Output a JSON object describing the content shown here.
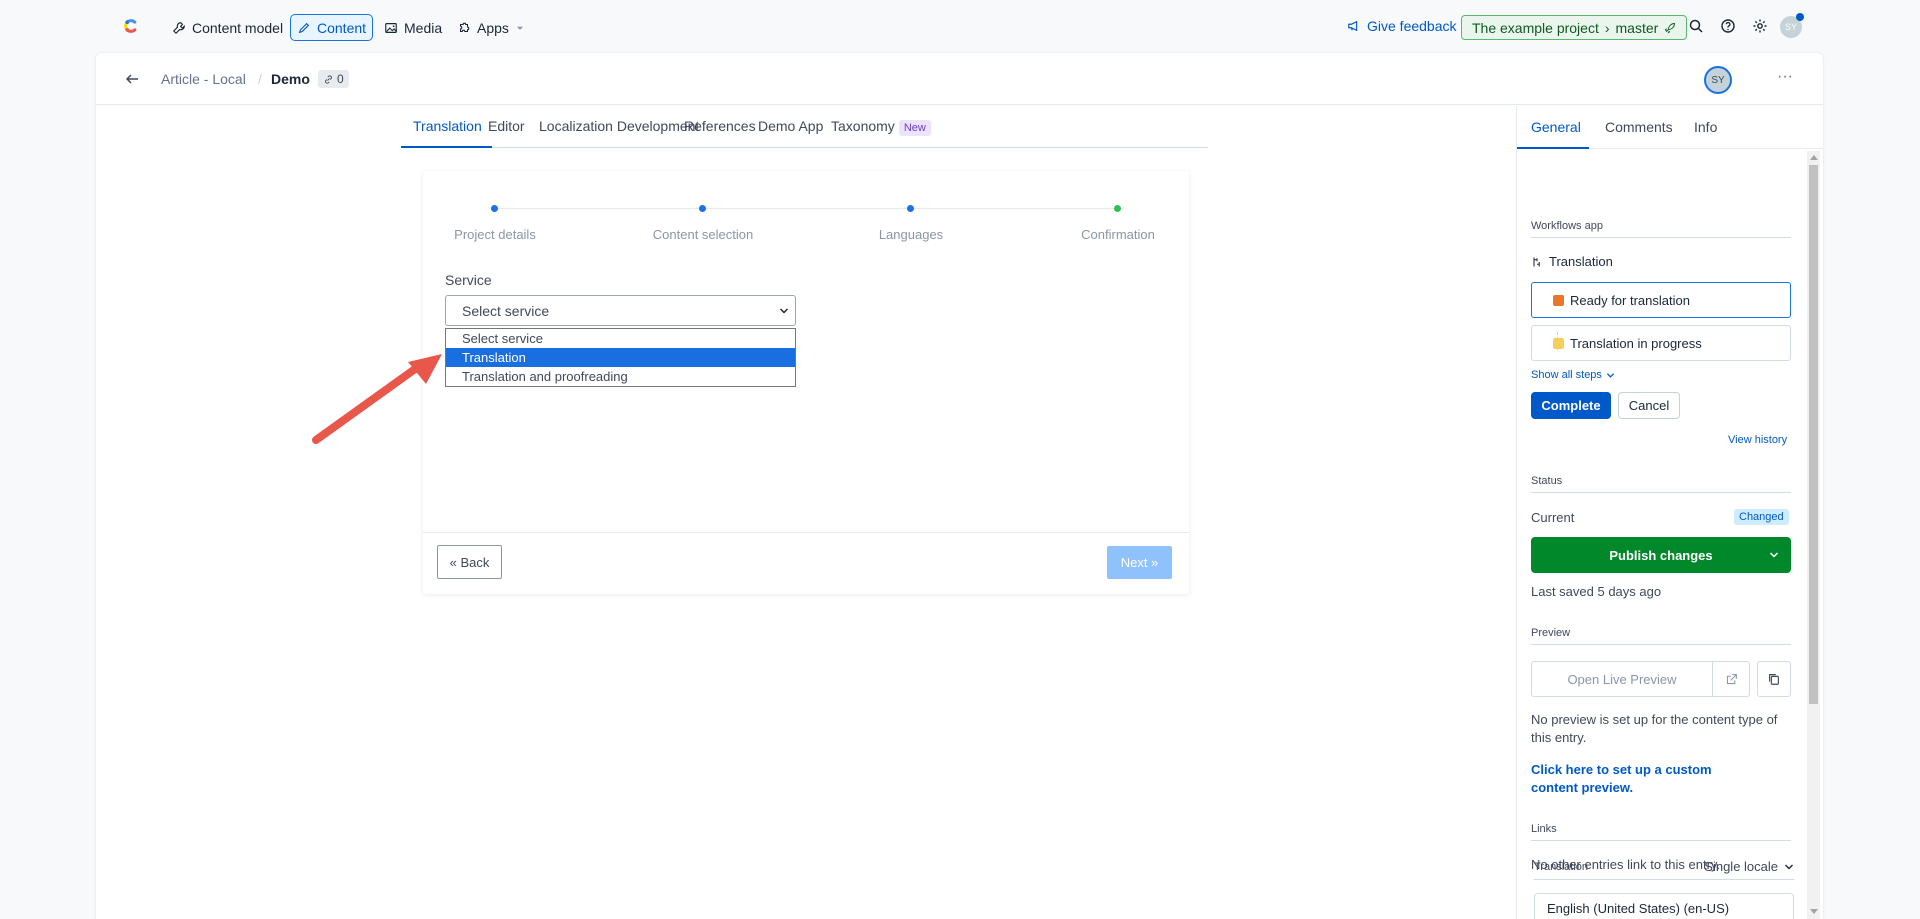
{
  "topnav": {
    "items": [
      {
        "label": "Content model",
        "icon": "wrench-icon"
      },
      {
        "label": "Content",
        "icon": "pen-icon"
      },
      {
        "label": "Media",
        "icon": "image-icon"
      },
      {
        "label": "Apps",
        "icon": "puzzle-icon"
      }
    ],
    "feedback": "Give feedback",
    "project": "The example project",
    "environment": "master",
    "avatar": "SY"
  },
  "header": {
    "crumbs": [
      "Article - Local",
      "Demo"
    ],
    "ref_count": "0",
    "avatar": "SY",
    "more": "···"
  },
  "tabs": [
    {
      "label": "Translation"
    },
    {
      "label": "Editor"
    },
    {
      "label": "Localization Development"
    },
    {
      "label": "References"
    },
    {
      "label": "Demo App"
    },
    {
      "label": "Taxonomy"
    }
  ],
  "tab_badge": "New",
  "wizard": {
    "steps": [
      "Project details",
      "Content selection",
      "Languages",
      "Confirmation"
    ],
    "service_label": "Service",
    "select_value": "Select service",
    "options": [
      "Select service",
      "Translation",
      "Translation and proofreading"
    ],
    "selected_option": "Translation",
    "back": "« Back",
    "next": "Next »"
  },
  "sidebar": {
    "tabs": [
      "General",
      "Comments",
      "Info"
    ],
    "workflows_heading": "Workflows app",
    "workflow_name": "Translation",
    "steps": [
      {
        "label": "Ready for translation",
        "color": "#e8762c"
      },
      {
        "label": "Translation in progress",
        "color": "#f5cf5c"
      }
    ],
    "show_all": "Show all steps",
    "complete": "Complete",
    "cancel": "Cancel",
    "view_history": "View history",
    "status_heading": "Status",
    "current_label": "Current",
    "changed_badge": "Changed",
    "publish": "Publish changes",
    "last_saved": "Last saved 5 days ago",
    "preview_heading": "Preview",
    "open_live_preview": "Open Live Preview",
    "preview_note": "No preview is set up for the content type of this entry.",
    "preview_link": "Click here to set up a custom content preview.",
    "links_heading": "Links",
    "links_note": "No other entries link to this entry.",
    "translation_heading": "Translation",
    "locale_mode": "Single locale",
    "locale_value": "English (United States) (en-US)"
  },
  "colors": {
    "accent": "#0059c8",
    "publish": "#00882a",
    "option_highlight": "#1a6fe0",
    "arrow": "#e8574a"
  }
}
